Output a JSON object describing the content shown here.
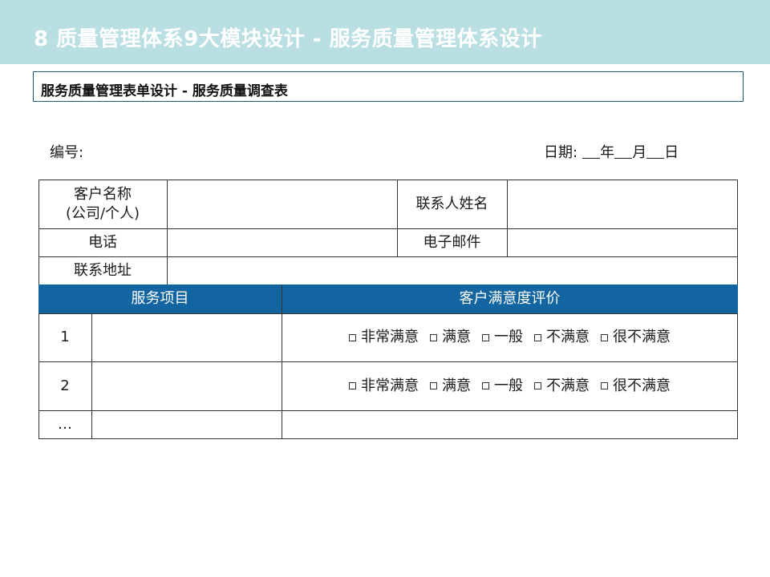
{
  "slide": {
    "title": "8   质量管理体系9大模块设计 - 服务质量管理体系设计",
    "subtitle": "服务质量管理表单设计 - 服务质量调查表"
  },
  "form": {
    "serial_label": "编号:",
    "date_label": "日期:",
    "date_year": "年",
    "date_month": "月",
    "date_day": "日",
    "customer_name_label_line1": "客户名称",
    "customer_name_label_line2": "(公司/个人)",
    "contact_name_label": "联系人姓名",
    "phone_label": "电话",
    "email_label": "电子邮件",
    "address_label": "联系地址"
  },
  "table": {
    "header_service": "服务项目",
    "header_rating": "客户满意度评价",
    "rows": [
      {
        "number": "1"
      },
      {
        "number": "2"
      },
      {
        "number": "…"
      }
    ],
    "rating_options": [
      "非常满意",
      "满意",
      "一般",
      "不满意",
      "很不满意"
    ]
  },
  "colors": {
    "title_bar": "#b9dfe3",
    "header_band": "#1265a0",
    "subtitle_border": "#1f5f7a"
  }
}
